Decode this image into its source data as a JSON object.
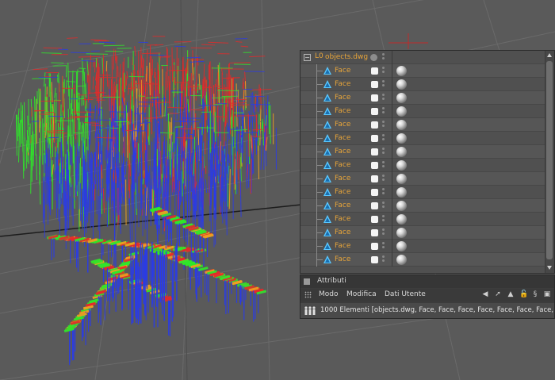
{
  "object_manager": {
    "root_label": "objects.dwg",
    "child_label": "Face",
    "child_icon": "face-object-icon",
    "material_icon": "material-sphere-icon",
    "rows": [
      "Face",
      "Face",
      "Face",
      "Face",
      "Face",
      "Face",
      "Face",
      "Face",
      "Face",
      "Face",
      "Face",
      "Face",
      "Face",
      "Face",
      "Face"
    ]
  },
  "attributes": {
    "title": "Attributi",
    "menu": {
      "mode": "Modo",
      "edit": "Modifica",
      "user_data": "Dati Utente"
    },
    "info": "1000 Elementi [objects.dwg, Face, Face, Face, Face, Face, Face, Face, Face,"
  },
  "colors": {
    "viewport_bg": "#5a5a5a",
    "accent_label": "#e6a43a",
    "mesh_red": "#e52a2a",
    "mesh_green": "#2fe82a",
    "mesh_blue": "#2a3be8",
    "mesh_orange": "#f0a020"
  }
}
